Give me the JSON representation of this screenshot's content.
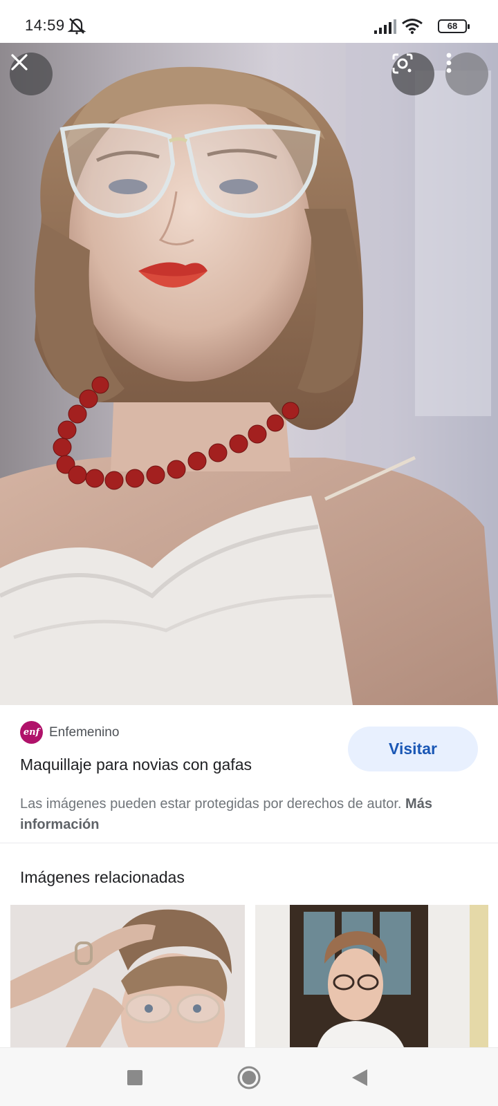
{
  "status_bar": {
    "time": "14:59",
    "battery": "68",
    "icons": [
      "mute-icon",
      "signal-icon",
      "wifi-icon",
      "battery-icon"
    ]
  },
  "viewer": {
    "close_icon": "close-icon",
    "lens_icon": "lens-icon",
    "more_icon": "more-vert-icon"
  },
  "result": {
    "source_logo": "enf",
    "source_name": "Enfemenino",
    "title": "Maquillaje para novias con gafas",
    "visit_label": "Visitar",
    "copyright_text": "Las imágenes pueden estar protegidas por derechos de autor.",
    "more_info_label": "Más información"
  },
  "related": {
    "heading": "Imágenes relacionadas"
  },
  "nav_bar": {
    "icons": [
      "recents-icon",
      "home-icon",
      "back-icon"
    ]
  },
  "colors": {
    "accent": "#1a57b5",
    "visit_bg": "#e8f0fe",
    "logo": "#b0126a"
  }
}
